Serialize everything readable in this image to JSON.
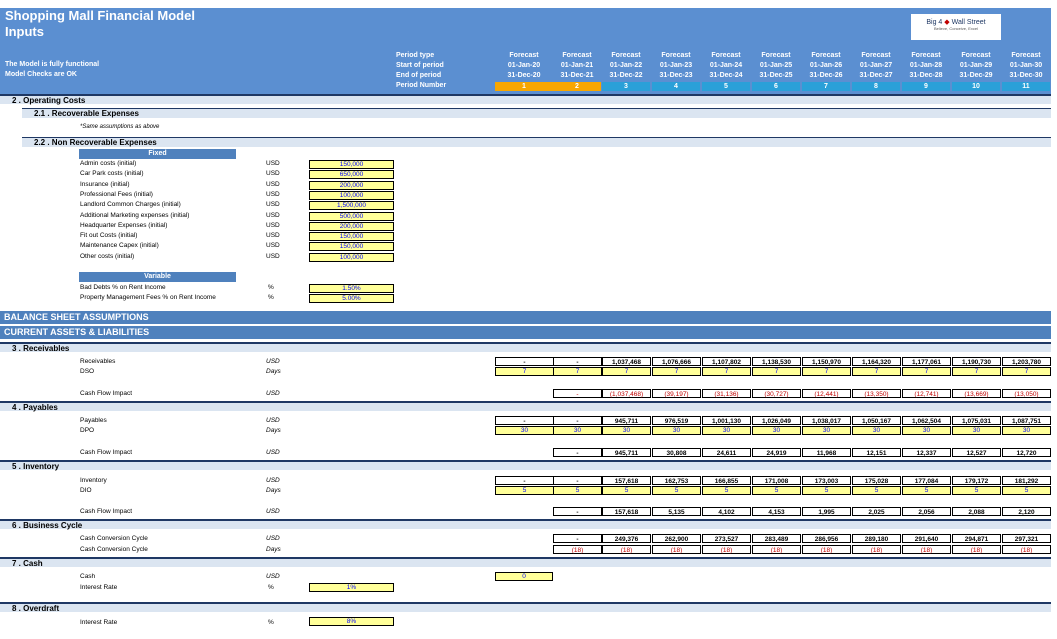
{
  "title": "Shopping Mall Financial Model",
  "subtitle": "Inputs",
  "logo": {
    "big4": "Big 4",
    "wall_street": "Wall Street",
    "tagline": "Believe, Conceive, Excel"
  },
  "status": {
    "functional": "The Model is fully functional",
    "checks": "Model Checks are OK"
  },
  "period_labels": {
    "type": "Period type",
    "start": "Start of period",
    "end": "End of period",
    "number": "Period Number"
  },
  "periods": [
    {
      "type": "Forecast",
      "start": "01-Jan-20",
      "end": "31-Dec-20",
      "num": "1"
    },
    {
      "type": "Forecast",
      "start": "01-Jan-21",
      "end": "31-Dec-21",
      "num": "2"
    },
    {
      "type": "Forecast",
      "start": "01-Jan-22",
      "end": "31-Dec-22",
      "num": "3"
    },
    {
      "type": "Forecast",
      "start": "01-Jan-23",
      "end": "31-Dec-23",
      "num": "4"
    },
    {
      "type": "Forecast",
      "start": "01-Jan-24",
      "end": "31-Dec-24",
      "num": "5"
    },
    {
      "type": "Forecast",
      "start": "01-Jan-25",
      "end": "31-Dec-25",
      "num": "6"
    },
    {
      "type": "Forecast",
      "start": "01-Jan-26",
      "end": "31-Dec-26",
      "num": "7"
    },
    {
      "type": "Forecast",
      "start": "01-Jan-27",
      "end": "31-Dec-27",
      "num": "8"
    },
    {
      "type": "Forecast",
      "start": "01-Jan-28",
      "end": "31-Dec-28",
      "num": "9"
    },
    {
      "type": "Forecast",
      "start": "01-Jan-29",
      "end": "31-Dec-29",
      "num": "10"
    },
    {
      "type": "Forecast",
      "start": "01-Jan-30",
      "end": "31-Dec-30",
      "num": "11"
    }
  ],
  "sections": {
    "operating": "2 . Operating Costs",
    "recoverable": "2.1 . Recoverable Expenses",
    "same_assumptions": "*Same assumptions as above",
    "nonrecoverable": "2.2 . Non Recoverable Expenses",
    "fixed": "Fixed",
    "variable": "Variable",
    "balance": "BALANCE SHEET ASSUMPTIONS",
    "current": "CURRENT ASSETS & LIABILITIES",
    "receivables": "3 . Receivables",
    "payables": "4 . Payables",
    "inventory": "5 . Inventory",
    "business": "6 . Business Cycle",
    "cash": "7 . Cash",
    "overdraft": "8 . Overdraft"
  },
  "fixed_costs": [
    {
      "label": "Admin costs (initial)",
      "unit": "USD",
      "value": "150,000"
    },
    {
      "label": "Car Park costs (initial)",
      "unit": "USD",
      "value": "650,000"
    },
    {
      "label": "Insurance (initial)",
      "unit": "USD",
      "value": "200,000"
    },
    {
      "label": "Professional Fees (initial)",
      "unit": "USD",
      "value": "100,000"
    },
    {
      "label": "Landlord Common Charges (initial)",
      "unit": "USD",
      "value": "1,500,000"
    },
    {
      "label": "Additional Marketing expenses (initial)",
      "unit": "USD",
      "value": "500,000"
    },
    {
      "label": "Headquarter Expenses (initial)",
      "unit": "USD",
      "value": "200,000"
    },
    {
      "label": "Fit out Costs (initial)",
      "unit": "USD",
      "value": "150,000"
    },
    {
      "label": "Maintenance Capex (initial)",
      "unit": "USD",
      "value": "150,000"
    },
    {
      "label": "Other costs (initial)",
      "unit": "USD",
      "value": "100,000"
    }
  ],
  "variable_costs": [
    {
      "label": "Bad Debts % on Rent Income",
      "unit": "%",
      "value": "1.50%"
    },
    {
      "label": "Property Management Fees % on Rent Income",
      "unit": "%",
      "value": "5.00%"
    }
  ],
  "receivables": {
    "rows": [
      {
        "label": "Receivables",
        "unit": "USD",
        "values": [
          "-",
          "-",
          "1,037,468",
          "1,076,666",
          "1,107,802",
          "1,138,530",
          "1,150,970",
          "1,164,320",
          "1,177,061",
          "1,190,730",
          "1,203,780"
        ]
      },
      {
        "label": "DSO",
        "unit": "Days",
        "values": [
          "7",
          "7",
          "7",
          "7",
          "7",
          "7",
          "7",
          "7",
          "7",
          "7",
          "7"
        ]
      }
    ],
    "cf": {
      "label": "Cash Flow Impact",
      "unit": "USD",
      "values": [
        "-",
        "(1,037,468)",
        "(39,197)",
        "(31,136)",
        "(30,727)",
        "(12,441)",
        "(13,350)",
        "(12,741)",
        "(13,669)",
        "(13,050)"
      ]
    }
  },
  "payables": {
    "rows": [
      {
        "label": "Payables",
        "unit": "USD",
        "values": [
          "-",
          "-",
          "945,711",
          "976,519",
          "1,001,130",
          "1,026,049",
          "1,038,017",
          "1,050,167",
          "1,062,504",
          "1,075,031",
          "1,087,751"
        ]
      },
      {
        "label": "DPO",
        "unit": "Days",
        "values": [
          "30",
          "30",
          "30",
          "30",
          "30",
          "30",
          "30",
          "30",
          "30",
          "30",
          "30"
        ]
      }
    ],
    "cf": {
      "label": "Cash Flow Impact",
      "unit": "USD",
      "values": [
        "-",
        "945,711",
        "30,808",
        "24,611",
        "24,919",
        "11,968",
        "12,151",
        "12,337",
        "12,527",
        "12,720"
      ]
    }
  },
  "inventory": {
    "rows": [
      {
        "label": "Inventory",
        "unit": "USD",
        "values": [
          "-",
          "-",
          "157,618",
          "162,753",
          "166,855",
          "171,008",
          "173,003",
          "175,028",
          "177,084",
          "179,172",
          "181,292"
        ]
      },
      {
        "label": "DIO",
        "unit": "Days",
        "values": [
          "5",
          "5",
          "5",
          "5",
          "5",
          "5",
          "5",
          "5",
          "5",
          "5",
          "5"
        ]
      }
    ],
    "cf": {
      "label": "Cash Flow Impact",
      "unit": "USD",
      "values": [
        "-",
        "157,618",
        "5,135",
        "4,102",
        "4,153",
        "1,995",
        "2,025",
        "2,056",
        "2,088",
        "2,120"
      ]
    }
  },
  "business": {
    "rows": [
      {
        "label": "Cash Conversion Cycle",
        "unit": "USD",
        "values": [
          "-",
          "249,376",
          "262,900",
          "273,527",
          "283,489",
          "286,956",
          "289,180",
          "291,640",
          "294,871",
          "297,321"
        ]
      },
      {
        "label": "Cash Conversion Cycle",
        "unit": "Days",
        "values": [
          "(18)",
          "(18)",
          "(18)",
          "(18)",
          "(18)",
          "(18)",
          "(18)",
          "(18)",
          "(18)",
          "(18)"
        ]
      }
    ]
  },
  "cash": {
    "label": "Cash",
    "unit": "USD",
    "value": "0",
    "rate_label": "Interest Rate",
    "rate_unit": "%",
    "rate": "1%"
  },
  "overdraft": {
    "rate_label": "Interest Rate",
    "rate_unit": "%",
    "rate": "8%"
  }
}
